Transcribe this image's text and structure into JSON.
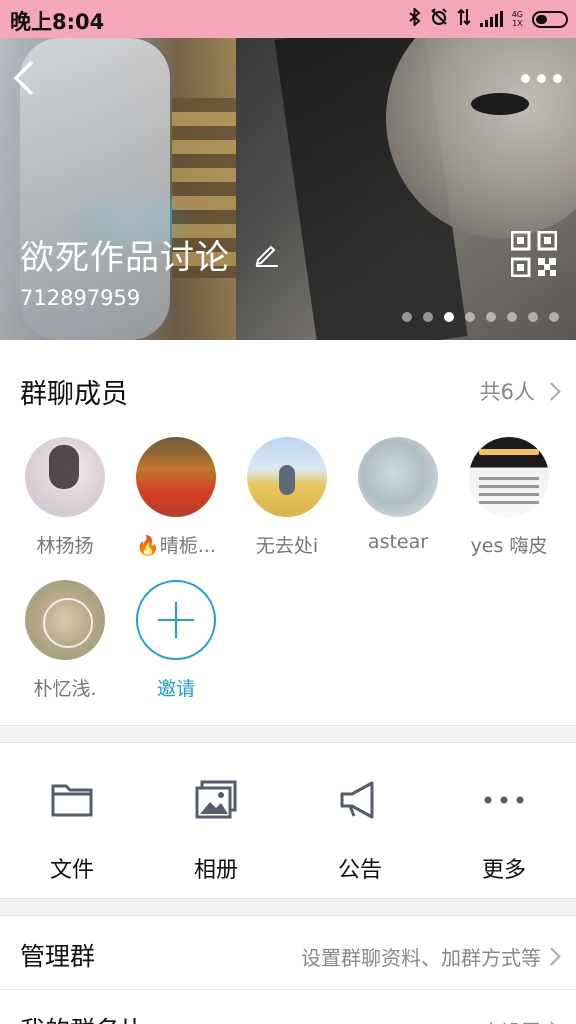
{
  "status_bar": {
    "time": "晚上8:04",
    "network_top": "4G",
    "network_bottom": "1X",
    "icons": [
      "bluetooth-icon",
      "alarm-off-icon",
      "data-arrows-icon",
      "signal-icon",
      "battery-icon"
    ]
  },
  "header": {
    "group_name": "欲死作品讨论",
    "group_id": "712897959",
    "carousel": {
      "total_pages": 8,
      "active_page": 3
    }
  },
  "members": {
    "title": "群聊成员",
    "count_label": "共6人",
    "items": [
      {
        "name": "林扬扬"
      },
      {
        "name": "晴栀...",
        "emoji": "🔥"
      },
      {
        "name": "无去处i"
      },
      {
        "name": "astear"
      },
      {
        "name": "yes 嗨皮"
      },
      {
        "name": "朴忆浅."
      }
    ],
    "invite_label": "邀请"
  },
  "actions": [
    {
      "label": "文件",
      "icon": "folder-icon"
    },
    {
      "label": "相册",
      "icon": "album-icon"
    },
    {
      "label": "公告",
      "icon": "announcement-icon"
    },
    {
      "label": "更多",
      "icon": "more-dots-icon"
    }
  ],
  "settings": {
    "manage": {
      "title": "管理群",
      "value": "设置群聊资料、加群方式等"
    },
    "card": {
      "title": "我的群名片",
      "value": "未设置"
    }
  },
  "colors": {
    "accent": "#1ca0db",
    "status_bar": "#f4a7b9"
  }
}
